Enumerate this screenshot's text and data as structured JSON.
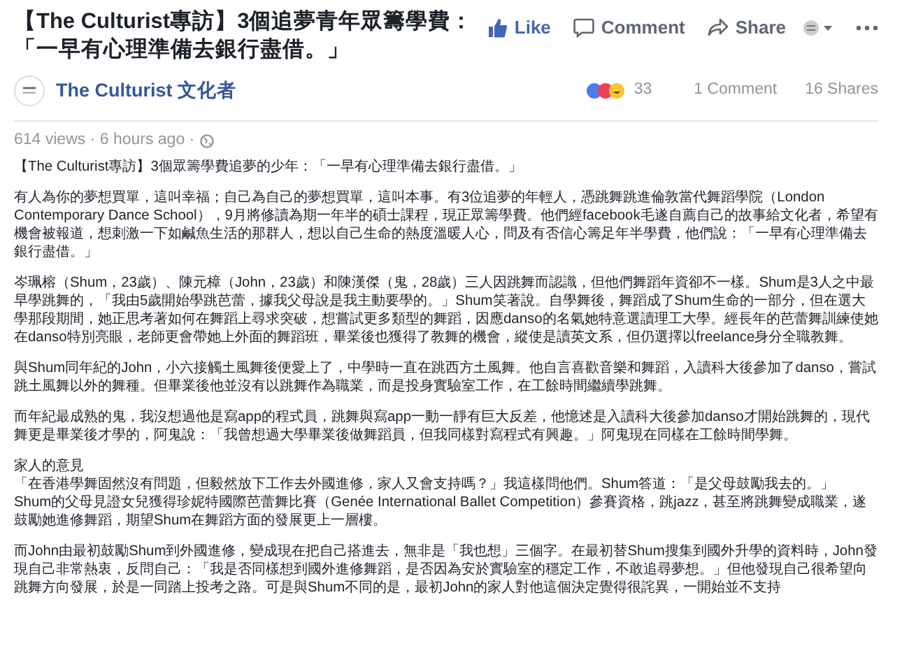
{
  "post": {
    "title": "【The Culturist專訪】3個追夢青年眾籌學費：「一早有心理準備去銀行盡借。」",
    "actions": [
      {
        "kind": "like",
        "label": "Like",
        "selected": true
      },
      {
        "kind": "comment",
        "label": "Comment",
        "selected": false
      },
      {
        "kind": "share",
        "label": "Share",
        "selected": false
      }
    ],
    "author": "The Culturist 文化者",
    "reaction_count": "33",
    "comments": "1 Comment",
    "shares": "16 Shares",
    "meta": "614 views · 6 hours ago ·",
    "body": [
      {
        "kind": "text",
        "text": "【The Culturist專訪】3個眾籌學費追夢的少年：「一早有心理準備去銀行盡借。」"
      },
      {
        "kind": "text",
        "text": "有人為你的夢想買單，這叫幸福；自己為自己的夢想買單，這叫本事。有3位追夢的年輕人，憑跳舞跳進倫敦當代舞蹈學院（London Contemporary Dance School），9月將修讀為期一年半的碩士課程，現正眾籌學費。他們經facebook毛遂自薦自己的故事給文化者，希望有機會被報道，想刺激一下如鹹魚生活的那群人，想以自己生命的熱度溫暖人心，問及有否信心籌足年半學費，他們說：「一早有心理準備去銀行盡借。」"
      },
      {
        "kind": "text",
        "text": "岑珮榕（Shum，23歲）、陳元樟（John，23歲）和陳漢傑（鬼，28歲）三人因跳舞而認識，但他們舞蹈年資卻不一樣。Shum是3人之中最早學跳舞的，「我由5歲開始學跳芭蕾，據我父母說是我主動要學的。」Shum笑著說。自學舞後，舞蹈成了Shum生命的一部分，但在選大學那段期間，她正思考著如何在舞蹈上尋求突破，想嘗試更多類型的舞蹈，因應danso的名氣她特意選讀理工大學。經長年的芭蕾舞訓練使她在danso特別亮眼，老師更會帶她上外面的舞蹈班，畢業後也獲得了教舞的機會，縱使是讀英文系，但仍選擇以freelance身分全職教舞。"
      },
      {
        "kind": "text",
        "text": "與Shum同年紀的John，小六接觸土風舞後便愛上了，中學時一直在跳西方土風舞。他自言喜歡音樂和舞蹈，入讀科大後參加了danso，嘗試跳土風舞以外的舞種。但畢業後他並沒有以跳舞作為職業，而是投身實驗室工作，在工餘時間繼續學跳舞。"
      },
      {
        "kind": "text",
        "text": "而年紀最成熟的鬼，我沒想過他是寫app的程式員，跳舞與寫app一動一靜有巨大反差，他憶述是入讀科大後參加danso才開始跳舞的，現代舞更是畢業後才學的，阿鬼說：「我曾想過大學畢業後做舞蹈員，但我同樣對寫程式有興趣。」阿鬼現在同樣在工餘時間學舞。"
      },
      {
        "kind": "section",
        "heading": "家人的意見",
        "texts": [
          "「在香港學舞固然沒有問題，但毅然放下工作去外國進修，家人又會支持嗎？」我這樣問他們。Shum答道：「是父母鼓勵我去的。」",
          "Shum的父母見證女兒獲得珍妮特國際芭蕾舞比賽（Genée International Ballet Competition）參賽資格，跳jazz，甚至將跳舞變成職業，遂鼓勵她進修舞蹈，期望Shum在舞蹈方面的發展更上一層樓。"
        ]
      },
      {
        "kind": "text",
        "text": "而John由最初鼓勵Shum到外國進修，變成現在把自己搭進去，無非是「我也想」三個字。在最初替Shum搜集到國外升學的資料時，John發現自己非常熱衷，反問自己：「我是否同樣想到國外進修舞蹈，是否因為安於實驗室的穩定工作，不敢追尋夢想。」但他發現自己很希望向跳舞方向發展，於是一同踏上投考之路。可是與Shum不同的是，最初John的家人對他這個決定覺得很詫異，一開始並不支持"
      }
    ]
  }
}
